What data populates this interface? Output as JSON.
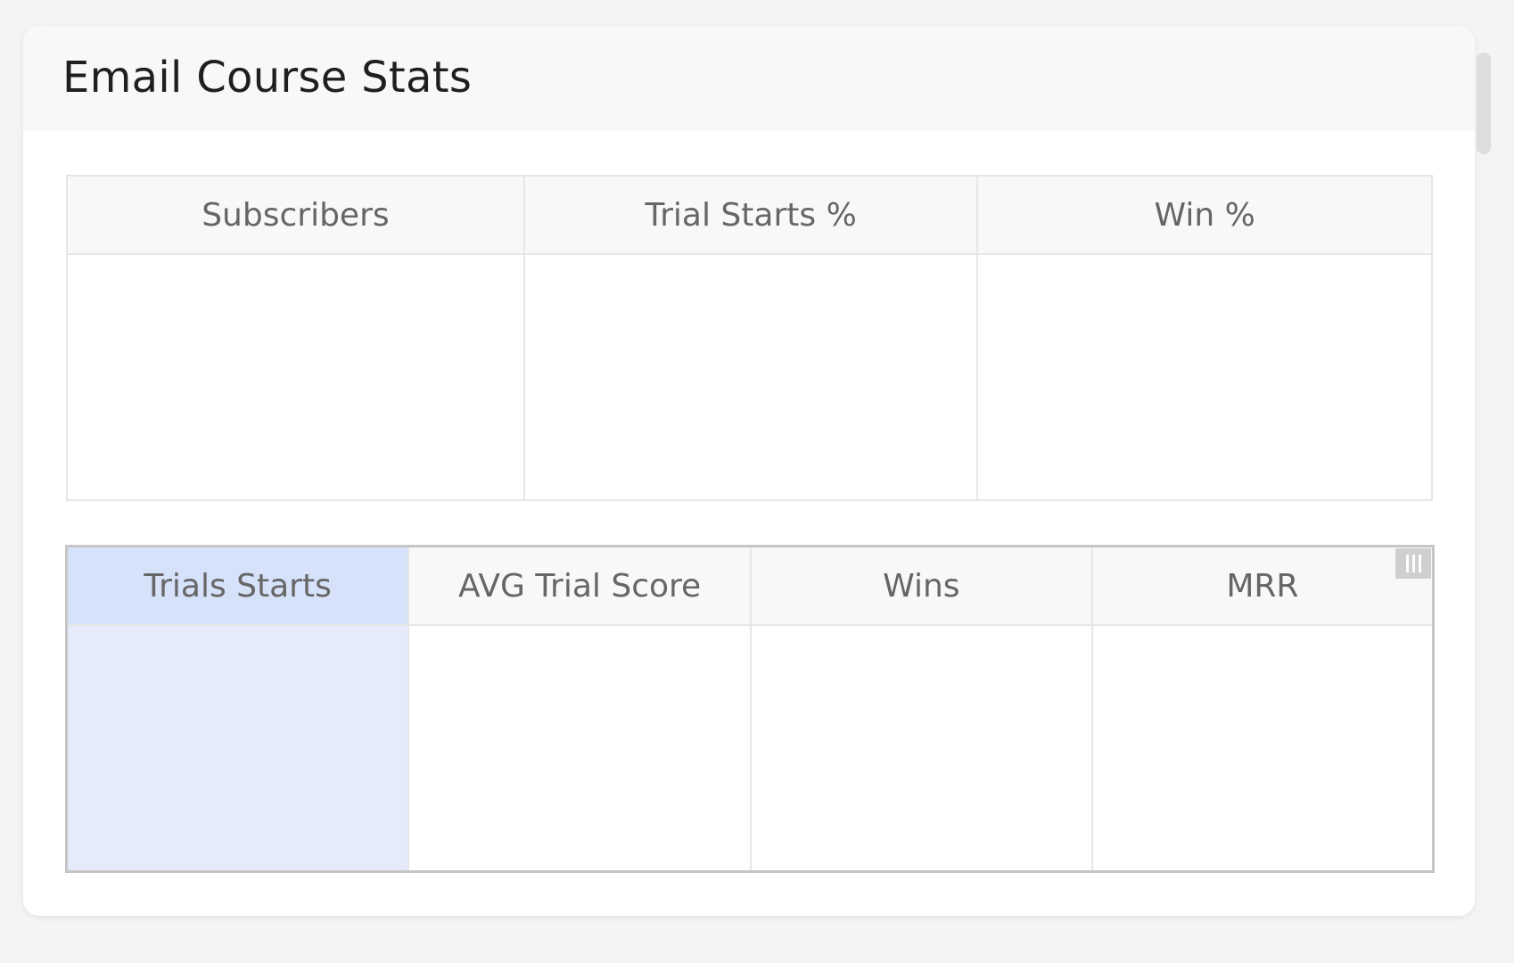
{
  "widget": {
    "title": "Email Course Stats"
  },
  "top_table": {
    "columns": [
      "Subscribers",
      "Trial Starts %",
      "Win %"
    ]
  },
  "bottom_table": {
    "columns": [
      "Trials Starts",
      "AVG Trial Score",
      "Wins",
      "MRR"
    ],
    "selected_column": "Trials Starts",
    "column_menu_icon": "column-menu-icon"
  },
  "colors": {
    "selected_header": "#d6e1fa",
    "selected_cell": "#e5ebfb",
    "header_bg": "#f8f8f8",
    "border": "#e6e6e6"
  }
}
